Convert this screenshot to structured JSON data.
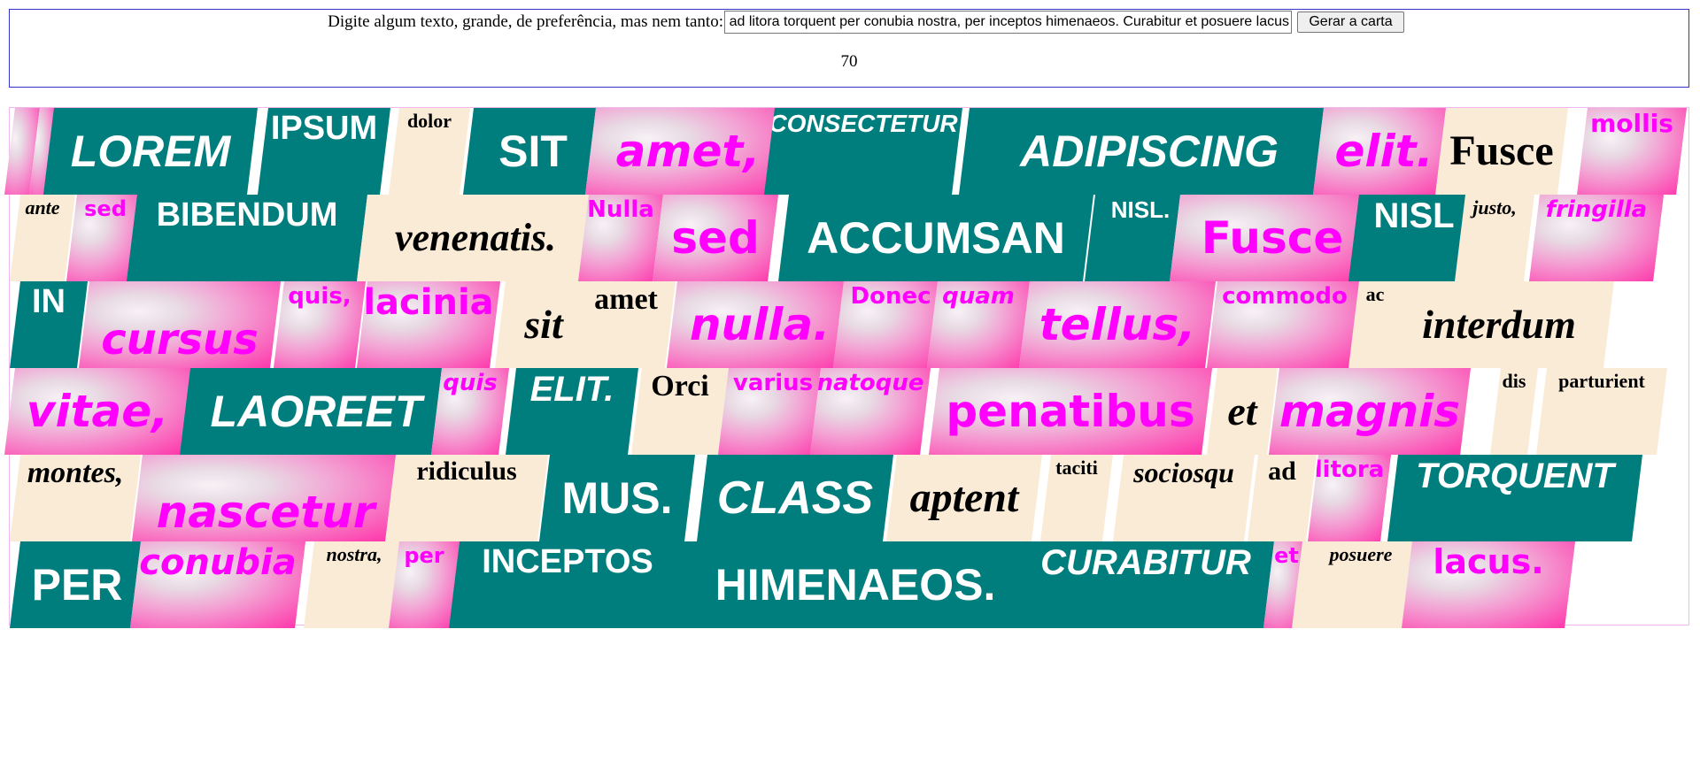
{
  "controls": {
    "prompt_label": "Digite algum texto, grande, de preferência, mas nem tanto:",
    "input_value": "Lorem ipsum dolor sit amet, consectetur adipiscing elit. Fusce mollis ante sed bibendum venenatis. Nulla sed accumsan nisl. Fusce nisl justo, fringilla in cursus quis, lacinia sit amet nulla. Donec quam tellus, commodo ac interdum vitae, laoreet quis elit. Orci varius natoque penatibus et magnis dis parturient montes, nascetur ridiculus mus. Class aptent taciti sociosqu ad litora torquent per conubia nostra, per inceptos himenaeos. Curabitur et posuere lacus.",
    "generate_button_label": "Gerar a carta",
    "word_count": "70"
  },
  "colors": {
    "teal": "#007d7d",
    "cream": "#faebd7",
    "magenta_text": "#ff00ff",
    "pink_tile": "#ff2fa8"
  },
  "card": {
    "words": [
      {
        "t": "",
        "s": "pink"
      },
      {
        "t": "",
        "s": "pink"
      },
      {
        "t": "LOREM",
        "s": "teal",
        "i": true
      },
      {
        "t": "IPSUM",
        "s": "teal"
      },
      {
        "t": "dolor",
        "s": "cream"
      },
      {
        "t": "SIT",
        "s": "teal"
      },
      {
        "t": "amet,",
        "s": "pink",
        "i": true
      },
      {
        "t": "CONSECTETUR",
        "s": "teal",
        "i": true
      },
      {
        "t": "ADIPISCING",
        "s": "teal",
        "i": true
      },
      {
        "t": "elit.",
        "s": "pink",
        "i": true
      },
      {
        "t": "Fusce",
        "s": "cream"
      },
      {
        "t": "mollis",
        "s": "pink"
      },
      {
        "t": "ante",
        "s": "cream",
        "i": true
      },
      {
        "t": "sed",
        "s": "pink"
      },
      {
        "t": "BIBENDUM",
        "s": "teal"
      },
      {
        "t": "venenatis.",
        "s": "cream",
        "i": true
      },
      {
        "t": "Nulla",
        "s": "pink"
      },
      {
        "t": "sed",
        "s": "pink"
      },
      {
        "t": "ACCUMSAN",
        "s": "teal"
      },
      {
        "t": "NISL.",
        "s": "teal"
      },
      {
        "t": "Fusce",
        "s": "pink"
      },
      {
        "t": "NISL",
        "s": "teal"
      },
      {
        "t": "justo,",
        "s": "cream",
        "i": true
      },
      {
        "t": "fringilla",
        "s": "pink",
        "i": true
      },
      {
        "t": "IN",
        "s": "teal"
      },
      {
        "t": "cursus",
        "s": "pink",
        "i": true
      },
      {
        "t": "quis,",
        "s": "pink"
      },
      {
        "t": "lacinia",
        "s": "pink"
      },
      {
        "t": "sit",
        "s": "cream",
        "i": true
      },
      {
        "t": "amet",
        "s": "cream"
      },
      {
        "t": "nulla.",
        "s": "pink",
        "i": true
      },
      {
        "t": "Donec",
        "s": "pink"
      },
      {
        "t": "quam",
        "s": "pink",
        "i": true
      },
      {
        "t": "tellus,",
        "s": "pink",
        "i": true
      },
      {
        "t": "commodo",
        "s": "pink"
      },
      {
        "t": "ac",
        "s": "cream"
      },
      {
        "t": "interdum",
        "s": "cream",
        "i": true
      },
      {
        "t": "vitae,",
        "s": "pink",
        "i": true
      },
      {
        "t": "LAOREET",
        "s": "teal",
        "i": true
      },
      {
        "t": "quis",
        "s": "pink",
        "i": true
      },
      {
        "t": "ELIT.",
        "s": "teal",
        "i": true
      },
      {
        "t": "Orci",
        "s": "cream"
      },
      {
        "t": "varius",
        "s": "pink"
      },
      {
        "t": "natoque",
        "s": "pink",
        "i": true
      },
      {
        "t": "penatibus",
        "s": "pink"
      },
      {
        "t": "et",
        "s": "cream",
        "i": true
      },
      {
        "t": "magnis",
        "s": "pink",
        "i": true
      },
      {
        "t": "dis",
        "s": "cream"
      },
      {
        "t": "parturient",
        "s": "cream"
      },
      {
        "t": "montes,",
        "s": "cream",
        "i": true
      },
      {
        "t": "nascetur",
        "s": "pink",
        "i": true
      },
      {
        "t": "ridiculus",
        "s": "cream"
      },
      {
        "t": "MUS.",
        "s": "teal"
      },
      {
        "t": "CLASS",
        "s": "teal",
        "i": true
      },
      {
        "t": "aptent",
        "s": "cream",
        "i": true
      },
      {
        "t": "taciti",
        "s": "cream"
      },
      {
        "t": "sociosqu",
        "s": "cream",
        "i": true
      },
      {
        "t": "ad",
        "s": "cream"
      },
      {
        "t": "litora",
        "s": "pink"
      },
      {
        "t": "TORQUENT",
        "s": "teal",
        "i": true
      },
      {
        "t": "PER",
        "s": "teal"
      },
      {
        "t": "conubia",
        "s": "pink",
        "i": true
      },
      {
        "t": "nostra,",
        "s": "cream",
        "i": true
      },
      {
        "t": "per",
        "s": "pink"
      },
      {
        "t": "INCEPTOS",
        "s": "teal"
      },
      {
        "t": "HIMENAEOS.",
        "s": "teal"
      },
      {
        "t": "CURABITUR",
        "s": "teal",
        "i": true
      },
      {
        "t": "et",
        "s": "pink"
      },
      {
        "t": "posuere",
        "s": "cream",
        "i": true
      },
      {
        "t": "lacus.",
        "s": "pink"
      }
    ]
  }
}
